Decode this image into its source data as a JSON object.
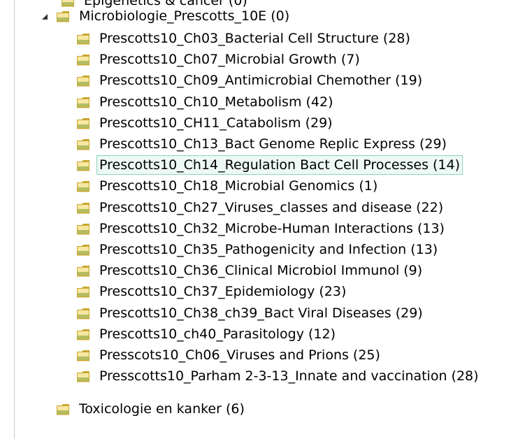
{
  "colors": {
    "folder_light": "#f7e7a2",
    "folder_dark": "#c9a72d",
    "folder_green": "#7d9b2e",
    "selection_bg": "#eef8f4",
    "selection_border": "#8ad5bd"
  },
  "tree": {
    "partial_top_label": "Epigenetics & cancer (0)",
    "parent": {
      "label": "Microbiologie_Prescotts_10E (0)",
      "expanded": true,
      "children": [
        {
          "label": "Prescotts10_Ch03_Bacterial Cell Structure (28)"
        },
        {
          "label": "Prescotts10_Ch07_Microbial Growth (7)"
        },
        {
          "label": "Prescotts10_Ch09_Antimicrobial Chemother (19)"
        },
        {
          "label": "Prescotts10_Ch10_Metabolism (42)"
        },
        {
          "label": "Prescotts10_CH11_Catabolism (29)"
        },
        {
          "label": "Prescotts10_Ch13_Bact Genome Replic Express (29)"
        },
        {
          "label": "Prescotts10_Ch14_Regulation Bact Cell Processes (14)",
          "selected": true
        },
        {
          "label": "Prescotts10_Ch18_Microbial Genomics (1)"
        },
        {
          "label": "Prescotts10_Ch27_Viruses_classes and disease (22)"
        },
        {
          "label": "Prescotts10_Ch32_Microbe-Human Interactions (13)"
        },
        {
          "label": "Prescotts10_Ch35_Pathogenicity and Infection (13)"
        },
        {
          "label": "Prescotts10_Ch36_Clinical Microbiol Immunol (9)"
        },
        {
          "label": "Prescotts10_Ch37_Epidemiology (23)"
        },
        {
          "label": "Prescotts10_Ch38_ch39_Bact Viral Diseases (29)"
        },
        {
          "label": "Prescotts10_ch40_Parasitology (12)"
        },
        {
          "label": "Presscots10_Ch06_Viruses and Prions (25)"
        },
        {
          "label": "Presscotts10_Parham 2-3-13_Innate and vaccination (28)"
        }
      ]
    },
    "sibling": {
      "label": "Toxicologie en kanker (6)"
    }
  }
}
